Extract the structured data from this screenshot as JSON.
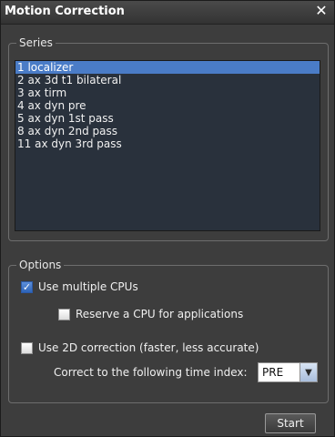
{
  "window": {
    "title": "Motion Correction",
    "close_label": "✕"
  },
  "series": {
    "legend": "Series",
    "items": [
      {
        "label": "1 localizer",
        "selected": true
      },
      {
        "label": "2 ax 3d t1 bilateral",
        "selected": false
      },
      {
        "label": "3 ax tirm",
        "selected": false
      },
      {
        "label": "4 ax dyn pre",
        "selected": false
      },
      {
        "label": "5 ax dyn 1st pass",
        "selected": false
      },
      {
        "label": "8 ax dyn 2nd pass",
        "selected": false
      },
      {
        "label": "11 ax dyn 3rd pass",
        "selected": false
      }
    ]
  },
  "options": {
    "legend": "Options",
    "use_multiple_cpus": {
      "label": "Use multiple CPUs",
      "checked": true
    },
    "reserve_cpu": {
      "label": "Reserve a CPU for applications",
      "checked": false
    },
    "use_2d": {
      "label": "Use 2D correction (faster, less accurate)",
      "checked": false
    },
    "time_index": {
      "label": "Correct to the following time index:",
      "value": "PRE"
    }
  },
  "actions": {
    "start_label": "Start"
  },
  "colors": {
    "selection": "#4a7cc7",
    "list_background": "#29313c",
    "window_background": "#3d3d3d"
  }
}
